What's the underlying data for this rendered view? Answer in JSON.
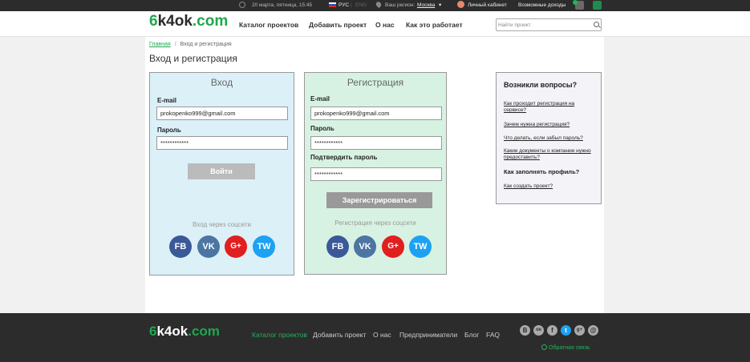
{
  "topbar": {
    "datetime": "20 марта, пятница, 15:45",
    "lang_active": "РУС",
    "lang_sep": "|",
    "lang_other": "ENG",
    "region_label": "Ваш регион:",
    "region_value": "Москва",
    "region_arrow": "▾",
    "account": "Личный кабинет",
    "income": "Возможные доходы"
  },
  "logo": {
    "six": "6",
    "name": "k4ok",
    "com": ".com"
  },
  "nav": {
    "catalog": "Каталог проектов",
    "add": "Добавить проект",
    "about": "О нас",
    "how": "Как это работает"
  },
  "search": {
    "placeholder": "Найти проект"
  },
  "breadcrumb": {
    "home": "Главная",
    "sep": "/",
    "current": "Вход и регистрация"
  },
  "page_title": "Вход и регистрация",
  "login": {
    "title": "Вход",
    "email_label": "E-mail",
    "email_value": "prokopenko999@gmail.com",
    "password_label": "Пароль",
    "password_value": "************",
    "submit": "Войти",
    "social_label": "Вход через соцсети"
  },
  "register": {
    "title": "Регистрация",
    "email_label": "E-mail",
    "email_value": "prokopenko999@gmail.com",
    "password_label": "Пароль",
    "password_value": "************",
    "confirm_label": "Подтвердить пароль",
    "confirm_value": "************",
    "submit": "Зарегистрироваться",
    "social_label": "Регистрация через соцсети"
  },
  "social": {
    "fb": "FB",
    "vk": "VK",
    "gp": "G+",
    "tw": "TW"
  },
  "faq": {
    "title": "Возникли вопросы?",
    "q1": "Как проходит регистрация на сервисе?",
    "q2": "Зачем нужна регистрация?",
    "q3": "Что делать, если забыл пароль?",
    "q4": "Какие документы о компании нужно предоставить?",
    "q5": "Как заполнять профиль?",
    "q6": "Как создать проект?"
  },
  "footer": {
    "catalog": "Каталог проектов",
    "add": "Добавить проект",
    "about": "О нас",
    "entrepreneurs": "Предприниматели",
    "blog": "Блог",
    "faq": "FAQ",
    "feedback": "Обратная связь",
    "social": {
      "b": "В",
      "ok": "ок",
      "f": "f",
      "t": "t",
      "gp": "g+",
      "at": "@"
    }
  },
  "colors": {
    "accent": "#1fa74e",
    "login_bg": "#dcf0f8",
    "register_bg": "#d7f2e2",
    "dark": "#2c2c2c"
  }
}
